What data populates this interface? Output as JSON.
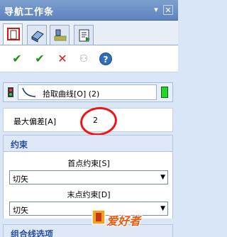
{
  "window": {
    "title": "导航工作条",
    "pin_glyph": "▾",
    "close_glyph": "✕"
  },
  "tabs": [
    {
      "icon": "dimension-icon",
      "active": true
    },
    {
      "icon": "solid-icon",
      "active": false
    },
    {
      "icon": "tools-icon",
      "active": false
    },
    {
      "icon": "export-icon",
      "active": false
    }
  ],
  "toolbar": {
    "ok_glyph": "✔",
    "apply_glyph": "✔",
    "cancel_glyph": "✕",
    "preview_glyph": "⚇",
    "help_glyph": "?"
  },
  "pick": {
    "label": "拾取曲线[O] (2)",
    "status_color": "#22d622"
  },
  "deviation": {
    "label": "最大偏差[A]",
    "value": "2"
  },
  "constraint": {
    "title": "约束",
    "start_label": "首点约束[S]",
    "start_value": "切矢",
    "end_label": "末点约束[D]",
    "end_value": "切矢",
    "arrow_glyph": "▼"
  },
  "group2": {
    "title": "组合线选项"
  },
  "watermark": {
    "text": "爱好者"
  },
  "colors": {
    "accent": "#27509a",
    "annotation_circle": "#f01515"
  }
}
